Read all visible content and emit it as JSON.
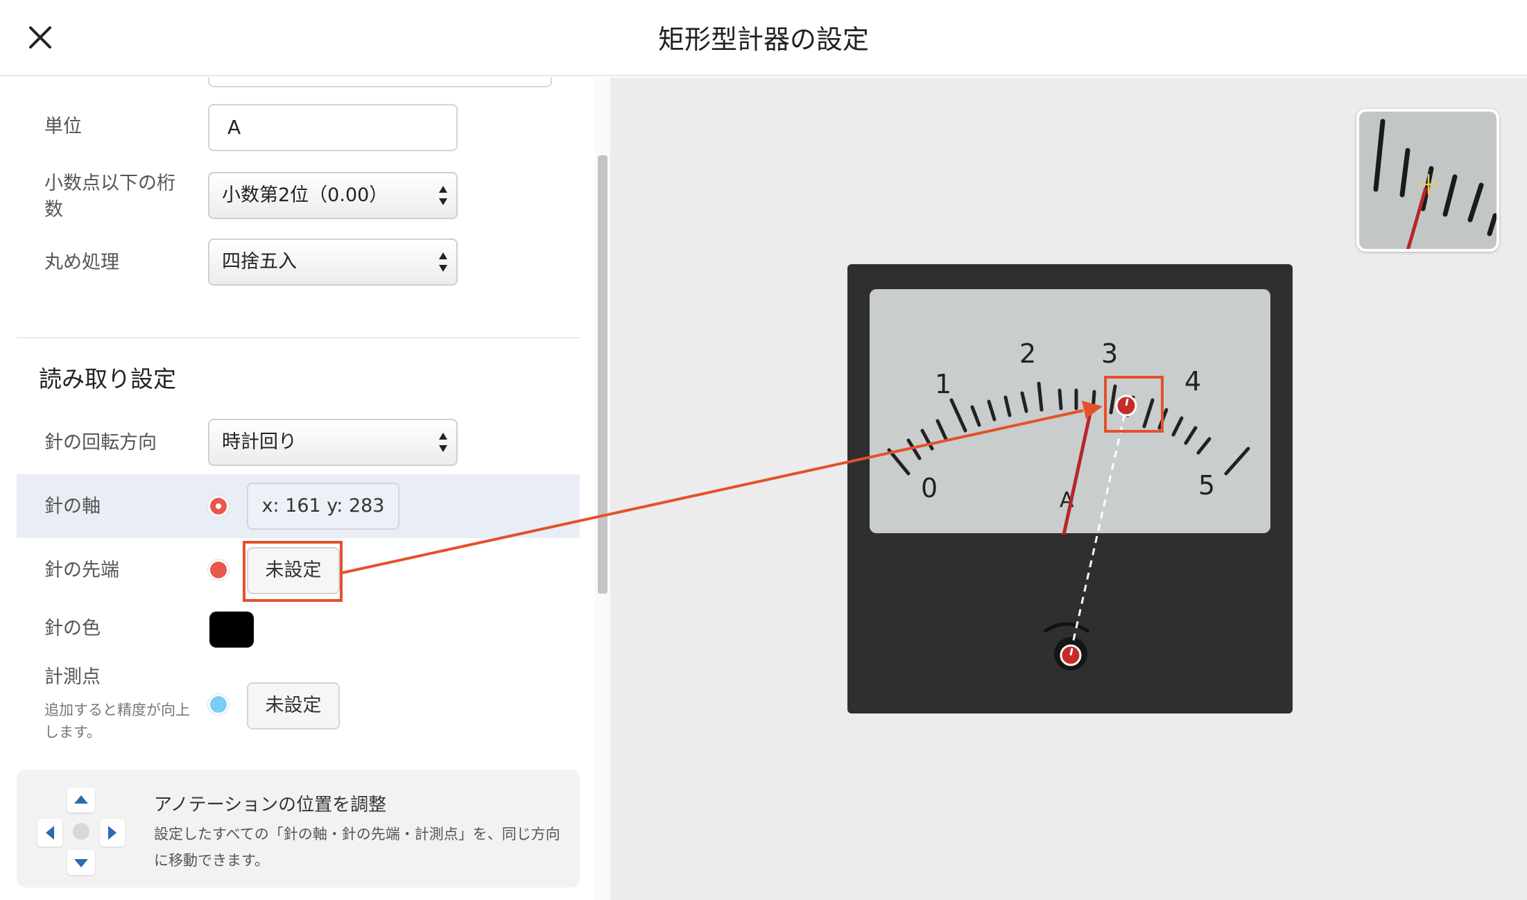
{
  "header": {
    "title": "矩形型計器の設定",
    "close_icon": "close-icon"
  },
  "form": {
    "unit": {
      "label": "単位",
      "value": "A"
    },
    "decimals": {
      "label": "小数点以下の桁数",
      "selected": "小数第2位（0.00）"
    },
    "rounding": {
      "label": "丸め処理",
      "selected": "四捨五入"
    }
  },
  "reading": {
    "section_title": "読み取り設定",
    "rotation": {
      "label": "針の回転方向",
      "selected": "時計回り"
    },
    "axis": {
      "label": "針の軸",
      "value": "x: 161 y: 283",
      "dot_color": "#e9574d"
    },
    "tip": {
      "label": "針の先端",
      "button": "未設定",
      "dot_color": "#e9574d"
    },
    "needle_color": {
      "label": "針の色",
      "value": "#000000"
    },
    "points": {
      "label": "計測点",
      "help": "追加すると精度が向上します。",
      "button": "未設定",
      "dot_color": "#79cdf5"
    }
  },
  "adjust": {
    "title": "アノテーションの位置を調整",
    "description": "設定したすべての「針の軸・針の先端・計測点」を、同じ方向に移動できます。",
    "icons": [
      "arrow-up-icon",
      "arrow-left-icon",
      "arrow-right-icon",
      "arrow-down-icon"
    ]
  },
  "meter_image": {
    "scale_labels": [
      "0",
      "1",
      "2",
      "3",
      "4",
      "5"
    ],
    "unit_label": "A"
  },
  "colors": {
    "accent": "#e4512a",
    "arrow_blue": "#2c6ab0"
  }
}
